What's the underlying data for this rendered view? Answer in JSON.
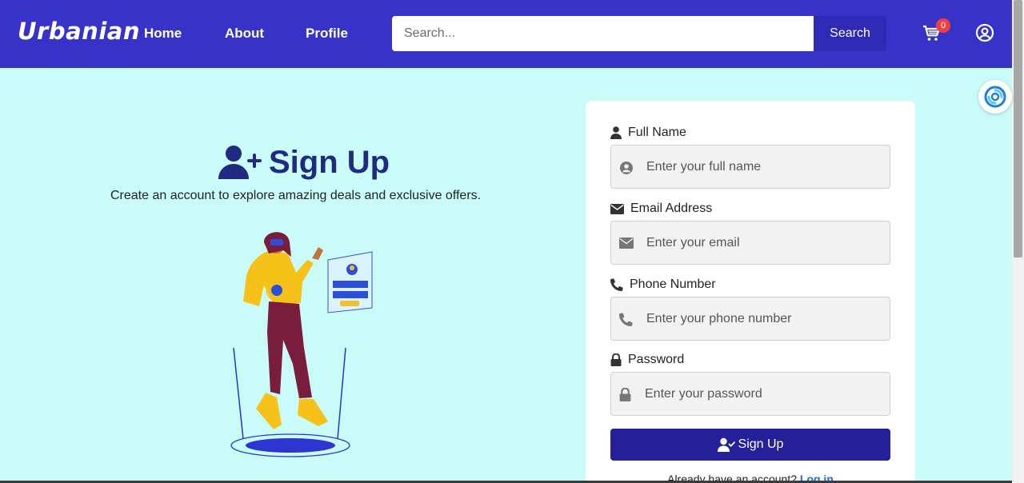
{
  "header": {
    "brand": "Urbanian",
    "nav": {
      "home": "Home",
      "about": "About",
      "profile": "Profile"
    },
    "search": {
      "placeholder": "Search...",
      "button": "Search"
    },
    "cart": {
      "icon": "cart-icon",
      "count": "0"
    },
    "account_icon": "user-circle-icon"
  },
  "hero": {
    "icon": "user-plus-icon",
    "title": "Sign Up",
    "subtitle": "Create an account to explore amazing deals and exclusive offers."
  },
  "form": {
    "full_name": {
      "label": "Full Name",
      "placeholder": "Enter your full name",
      "icon": "user-icon"
    },
    "email": {
      "label": "Email Address",
      "placeholder": "Enter your email",
      "icon": "envelope-icon"
    },
    "phone": {
      "label": "Phone Number",
      "placeholder": "Enter your phone number",
      "icon": "phone-icon"
    },
    "password": {
      "label": "Password",
      "placeholder": "Enter your password",
      "icon": "lock-icon"
    },
    "submit": "Sign Up",
    "login_prompt": "Already have an account?",
    "login_link": "Log in"
  },
  "colors": {
    "navbar": "#3733c9",
    "page_bg": "#c9fbf8",
    "title": "#1f2a80",
    "submit": "#23209a",
    "badge": "#f04040",
    "link": "#1a6bd6"
  }
}
